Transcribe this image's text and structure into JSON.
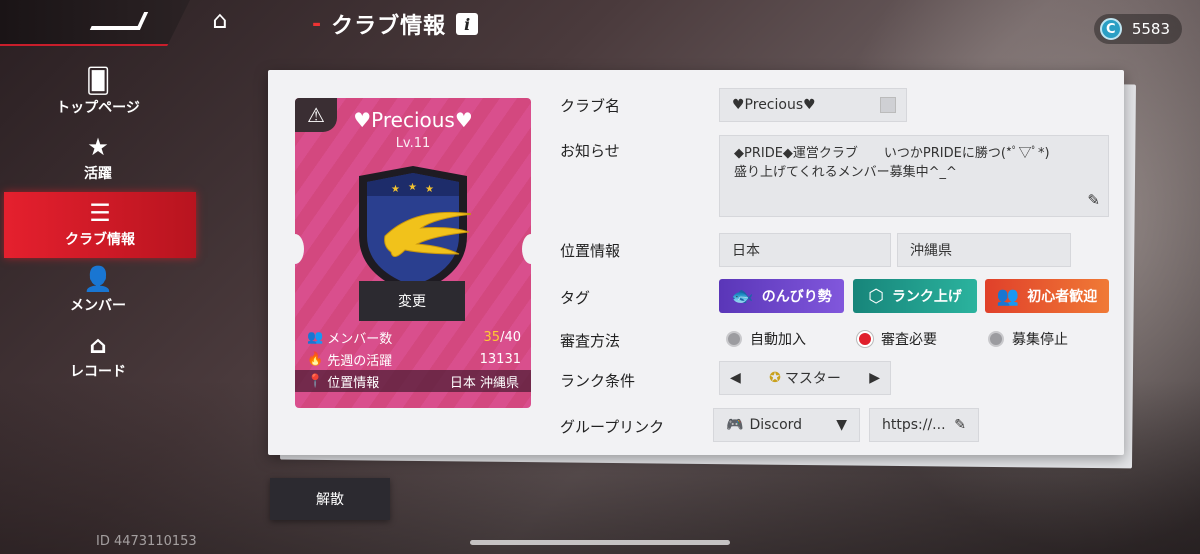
{
  "header": {
    "title": "クラブ情報",
    "title_prefix": "-",
    "info_label": "i",
    "currency_symbol": "C",
    "currency_value": "5583"
  },
  "sidebar": {
    "items": [
      {
        "label": "トップページ",
        "icon": "card-icon",
        "glyph": "🂠"
      },
      {
        "label": "活躍",
        "icon": "star-book-icon",
        "glyph": "★"
      },
      {
        "label": "クラブ情報",
        "icon": "list-icon",
        "glyph": "☰",
        "active": true
      },
      {
        "label": "メンバー",
        "icon": "member-icon",
        "glyph": "👤"
      },
      {
        "label": "レコード",
        "icon": "home-record-icon",
        "glyph": "⌂"
      }
    ]
  },
  "card": {
    "name": "♥Precious♥",
    "level": "Lv.11",
    "change_button": "変更",
    "stats": {
      "members_label": "メンバー数",
      "members_current": "35",
      "members_max": "/40",
      "activity_label": "先週の活躍",
      "activity_value": "13131",
      "location_label": "位置情報",
      "location_value": "日本 沖縄県"
    }
  },
  "form": {
    "club_name_label": "クラブ名",
    "club_name_value": "♥Precious♥",
    "notice_label": "お知らせ",
    "notice_line1": "◆PRIDE◆運営クラブ　　いつかPRIDEに勝つ(*ﾟ▽ﾟ*)",
    "notice_line2": "盛り上げてくれるメンバー募集中^_^",
    "location_label": "位置情報",
    "country": "日本",
    "prefecture": "沖縄県",
    "tag_label": "タグ",
    "tags": [
      {
        "label": "のんびり勢",
        "color": "#6a43c8"
      },
      {
        "label": "ランク上げ",
        "color": "#1f9a8a"
      },
      {
        "label": "初心者歓迎",
        "color": "#e2542a"
      }
    ],
    "review_label": "審査方法",
    "review_options": [
      {
        "label": "自動加入",
        "selected": false
      },
      {
        "label": "審査必要",
        "selected": true
      },
      {
        "label": "募集停止",
        "selected": false
      }
    ],
    "rank_label": "ランク条件",
    "rank_value": "マスター",
    "group_link_label": "グループリンク",
    "link_service": "Discord",
    "link_url": "https://..."
  },
  "footer": {
    "disband_button": "解散",
    "user_id": "ID 4473110153"
  }
}
